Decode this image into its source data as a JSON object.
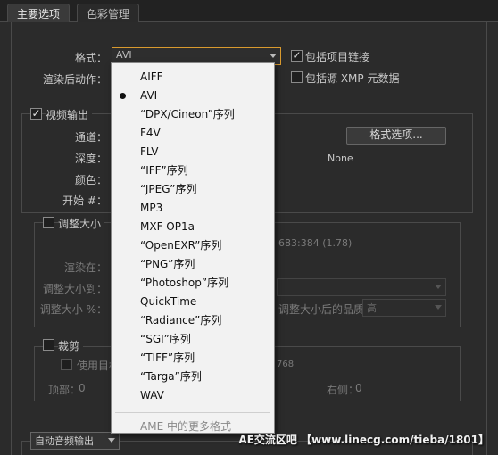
{
  "tabs": [
    {
      "label": "主要选项"
    },
    {
      "label": "色彩管理"
    }
  ],
  "format": {
    "label": "格式：",
    "value": "AVI"
  },
  "include_project_link": {
    "label": "包括项目链接",
    "checked": true
  },
  "post_render": {
    "label": "渲染后动作："
  },
  "include_xmp": {
    "label": "包括源 XMP 元数据",
    "checked": false
  },
  "video_output": {
    "label": "视频输出",
    "checked": true,
    "channels_label": "通道：",
    "depth_label": "深度：",
    "color_label": "颜色：",
    "start_label": "开始 #：",
    "format_options_button": "格式选项...",
    "codec_value": "None"
  },
  "resize": {
    "label": "调整大小",
    "checked": false,
    "render_at_label": "渲染在：",
    "resize_to_label": "调整大小到：",
    "resize_pct_label": "调整大小 %：",
    "ratio_text": "683:384 (1.78)",
    "quality_label": "调整大小后的品质：",
    "quality_value": "高"
  },
  "crop": {
    "label": "裁剪",
    "checked": false,
    "use_region_label": "使用目标",
    "region_value": "768",
    "top_label": "顶部：",
    "top_value": "0",
    "right_label": "右侧：",
    "right_value": "0"
  },
  "audio": {
    "label": "自动音频输出"
  },
  "format_menu": {
    "items": [
      {
        "label": "AIFF",
        "selected": false
      },
      {
        "label": "AVI",
        "selected": true
      },
      {
        "label": "“DPX/Cineon”序列",
        "selected": false
      },
      {
        "label": "F4V",
        "selected": false
      },
      {
        "label": "FLV",
        "selected": false
      },
      {
        "label": "“IFF”序列",
        "selected": false
      },
      {
        "label": "“JPEG”序列",
        "selected": false
      },
      {
        "label": "MP3",
        "selected": false
      },
      {
        "label": "MXF OP1a",
        "selected": false
      },
      {
        "label": "“OpenEXR”序列",
        "selected": false
      },
      {
        "label": "“PNG”序列",
        "selected": false
      },
      {
        "label": "“Photoshop”序列",
        "selected": false
      },
      {
        "label": "QuickTime",
        "selected": false
      },
      {
        "label": "“Radiance”序列",
        "selected": false
      },
      {
        "label": "“SGI”序列",
        "selected": false
      },
      {
        "label": "“TIFF”序列",
        "selected": false
      },
      {
        "label": "“Targa”序列",
        "selected": false
      },
      {
        "label": "WAV",
        "selected": false
      }
    ],
    "more_label": "AME 中的更多格式"
  },
  "watermark": "AE交流区吧 【www.linecg.com/tieba/1801】"
}
